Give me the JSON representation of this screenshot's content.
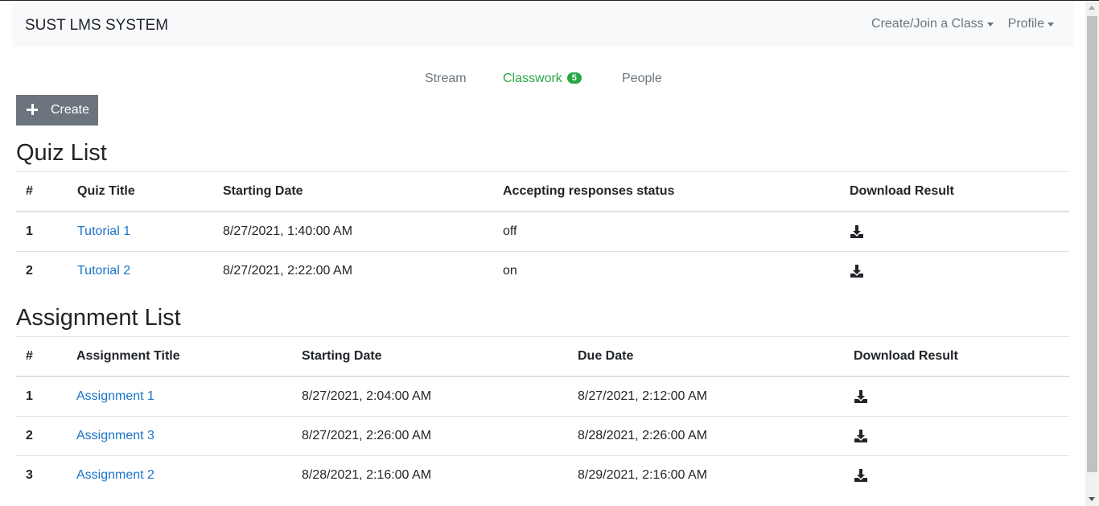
{
  "navbar": {
    "brand": "SUST LMS SYSTEM",
    "menu": [
      {
        "label": "Create/Join a Class"
      },
      {
        "label": "Profile"
      }
    ]
  },
  "tabs": {
    "stream": "Stream",
    "classwork": "Classwork",
    "classwork_badge": "5",
    "people": "People"
  },
  "create_button": {
    "label": "Create",
    "icon": "plus-icon"
  },
  "quiz": {
    "heading": "Quiz List",
    "columns": [
      "#",
      "Quiz Title",
      "Starting Date",
      "Accepting responses status",
      "Download Result"
    ],
    "rows": [
      {
        "num": "1",
        "title": "Tutorial 1",
        "start": "8/27/2021, 1:40:00 AM",
        "status": "off"
      },
      {
        "num": "2",
        "title": "Tutorial 2",
        "start": "8/27/2021, 2:22:00 AM",
        "status": "on"
      }
    ]
  },
  "assignment": {
    "heading": "Assignment List",
    "columns": [
      "#",
      "Assignment Title",
      "Starting Date",
      "Due Date",
      "Download Result"
    ],
    "rows": [
      {
        "num": "1",
        "title": "Assignment 1",
        "start": "8/27/2021, 2:04:00 AM",
        "due": "8/27/2021, 2:12:00 AM"
      },
      {
        "num": "2",
        "title": "Assignment 3",
        "start": "8/27/2021, 2:26:00 AM",
        "due": "8/28/2021, 2:26:00 AM"
      },
      {
        "num": "3",
        "title": "Assignment 2",
        "start": "8/28/2021, 2:16:00 AM",
        "due": "8/29/2021, 2:16:00 AM"
      }
    ]
  },
  "colors": {
    "accent": "#28a745",
    "link": "#1a73c9",
    "button": "#6c757d"
  },
  "icons": {
    "download": "download-icon"
  }
}
